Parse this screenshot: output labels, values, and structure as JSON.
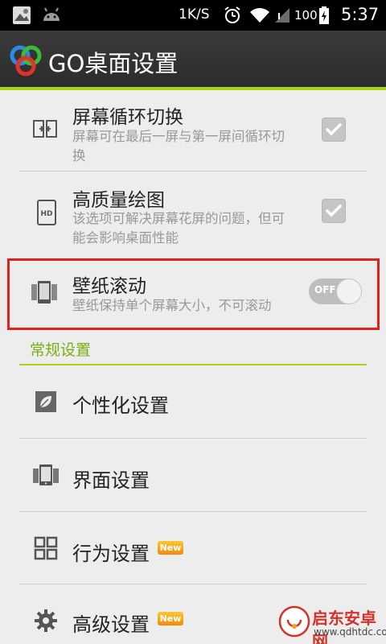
{
  "status_bar": {
    "speed": "1K/S",
    "battery": "100",
    "time": "5:37"
  },
  "app_bar": {
    "title": "GO桌面设置"
  },
  "settings": {
    "loop_screen": {
      "title": "屏幕循环切换",
      "desc_line1": "屏幕可在最后一屏与第一屏间循环切",
      "desc_line2": "换",
      "checked": true
    },
    "hq_drawing": {
      "title": "高质量绘图",
      "desc_line1": "该选项可解决屏幕花屏的问题，但可",
      "desc_line2": "能会影响桌面性能",
      "checked": true
    },
    "wallpaper_scroll": {
      "title": "壁纸滚动",
      "desc": "壁纸保持单个屏幕大小，不可滚动",
      "toggle_label": "OFF",
      "on": false
    }
  },
  "section": {
    "header": "常规设置"
  },
  "menu": {
    "personalize": "个性化设置",
    "interface": "界面设置",
    "behavior": "行为设置",
    "advanced": "高级设置",
    "new_badge": "New"
  },
  "watermark": {
    "name": "启东安卓网",
    "url": "www.qdhtdc.com"
  },
  "colors": {
    "accent": "#a8d51a",
    "highlight": "#e0211c",
    "section_text": "#7aae14"
  }
}
